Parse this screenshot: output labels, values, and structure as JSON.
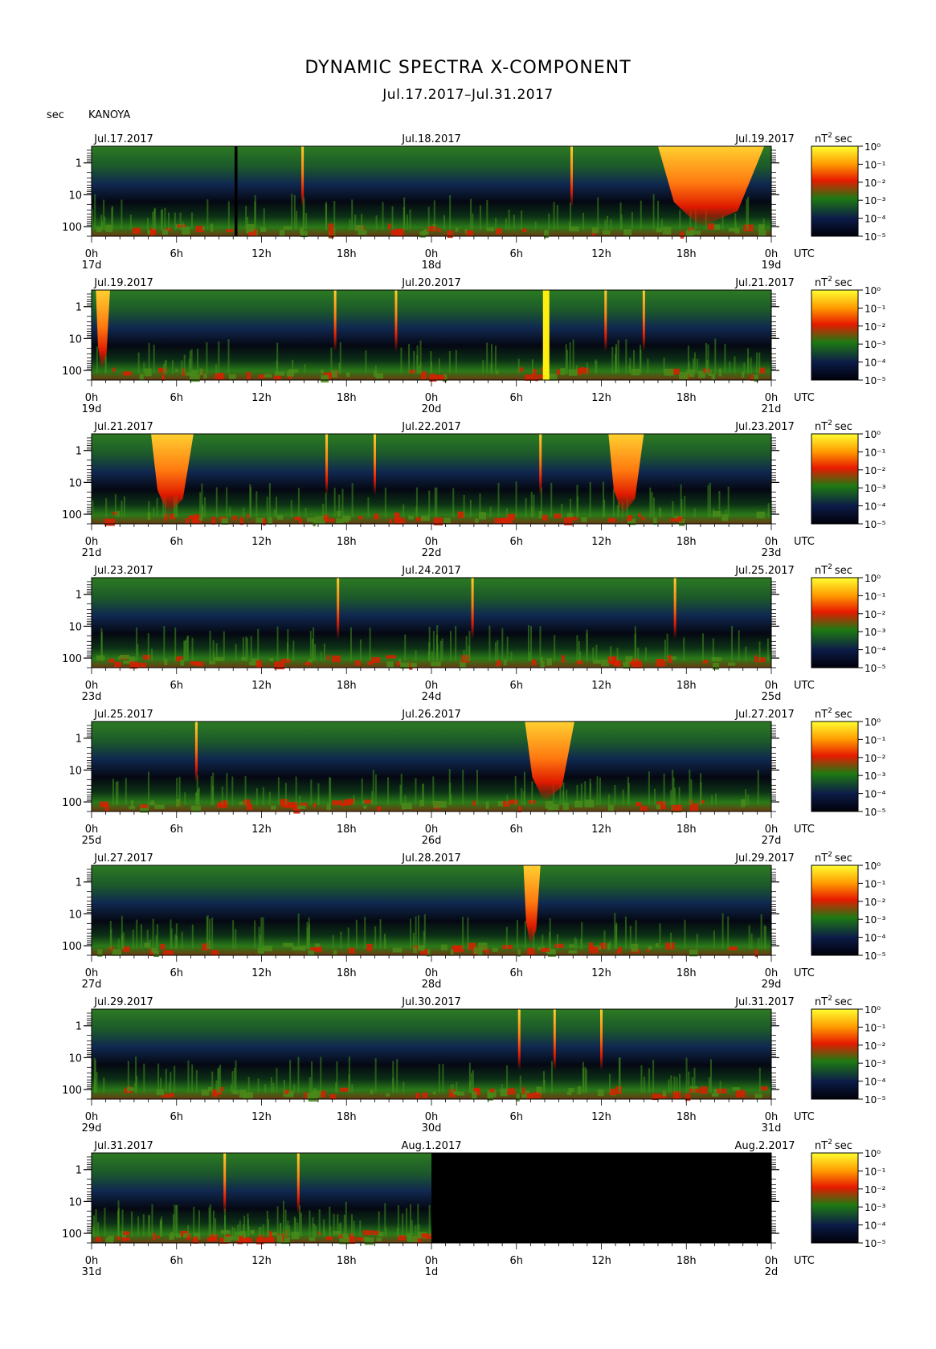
{
  "title": "DYNAMIC SPECTRA X-COMPONENT",
  "subtitle": "Jul.17.2017–Jul.31.2017",
  "station": "KANOYA",
  "yunit": "sec",
  "cbar_unit": "nT",
  "cbar_unit_sup": "2",
  "cbar_unit_suffix": "sec",
  "utc_label": "UTC",
  "chart_data": {
    "type": "heatmap",
    "xlabel": "UTC",
    "ylabel": "sec",
    "ylim": [
      0.3,
      200
    ],
    "yscale": "log",
    "yticks": [
      "1",
      "10",
      "100"
    ],
    "xticks": [
      "0h",
      "6h",
      "12h",
      "18h",
      "0h",
      "6h",
      "12h",
      "18h",
      "0h"
    ],
    "colorbar": {
      "unit": "nT² sec",
      "ticks": [
        "10⁰",
        "10⁻¹",
        "10⁻²",
        "10⁻³",
        "10⁻⁴",
        "10⁻⁵"
      ],
      "colors": [
        "#ffff00",
        "#ff9900",
        "#ff2200",
        "#1e7a12",
        "#10204a",
        "#000010"
      ]
    },
    "panels": [
      {
        "left_date": "Jul.17.2017",
        "mid_date": "Jul.18.2017",
        "right_date": "Jul.19.2017",
        "day_labels": [
          "17d",
          "18d",
          "19d"
        ],
        "events": [
          {
            "t": 14.9,
            "type": "spike"
          },
          {
            "t": 33.9,
            "type": "spike"
          },
          {
            "t": 40,
            "type": "storm",
            "width": 7.5
          }
        ],
        "gaps": [
          {
            "from": 10.1,
            "to": 10.3
          }
        ],
        "nodata_from": null
      },
      {
        "left_date": "Jul.19.2017",
        "mid_date": "Jul.20.2017",
        "right_date": "Jul.21.2017",
        "day_labels": [
          "19d",
          "20d",
          "21d"
        ],
        "events": [
          {
            "t": 0.3,
            "type": "storm",
            "width": 1
          },
          {
            "t": 17.2,
            "type": "spike"
          },
          {
            "t": 21.5,
            "type": "spike"
          },
          {
            "t": 32.1,
            "type": "block"
          },
          {
            "t": 36.3,
            "type": "spike"
          },
          {
            "t": 39.0,
            "type": "spike"
          }
        ],
        "gaps": [],
        "nodata_from": null
      },
      {
        "left_date": "Jul.21.2017",
        "mid_date": "Jul.22.2017",
        "right_date": "Jul.23.2017",
        "day_labels": [
          "21d",
          "22d",
          "23d"
        ],
        "events": [
          {
            "t": 4.2,
            "type": "storm",
            "width": 3
          },
          {
            "t": 16.6,
            "type": "spike"
          },
          {
            "t": 20.0,
            "type": "spike"
          },
          {
            "t": 31.7,
            "type": "spike"
          },
          {
            "t": 36.5,
            "type": "storm",
            "width": 2.5
          }
        ],
        "gaps": [],
        "nodata_from": null
      },
      {
        "left_date": "Jul.23.2017",
        "mid_date": "Jul.24.2017",
        "right_date": "Jul.25.2017",
        "day_labels": [
          "23d",
          "24d",
          "25d"
        ],
        "events": [
          {
            "t": 17.4,
            "type": "spike"
          },
          {
            "t": 26.9,
            "type": "spike"
          },
          {
            "t": 41.2,
            "type": "spike"
          }
        ],
        "gaps": [],
        "nodata_from": null
      },
      {
        "left_date": "Jul.25.2017",
        "mid_date": "Jul.26.2017",
        "right_date": "Jul.27.2017",
        "day_labels": [
          "25d",
          "26d",
          "27d"
        ],
        "events": [
          {
            "t": 7.4,
            "type": "spike"
          },
          {
            "t": 30.6,
            "type": "storm",
            "width": 3.5
          }
        ],
        "gaps": [],
        "nodata_from": null
      },
      {
        "left_date": "Jul.27.2017",
        "mid_date": "Jul.28.2017",
        "right_date": "Jul.29.2017",
        "day_labels": [
          "27d",
          "28d",
          "29d"
        ],
        "events": [
          {
            "t": 30.5,
            "type": "storm",
            "width": 1.2
          }
        ],
        "gaps": [],
        "nodata_from": null
      },
      {
        "left_date": "Jul.29.2017",
        "mid_date": "Jul.30.2017",
        "right_date": "Jul.31.2017",
        "day_labels": [
          "29d",
          "30d",
          "31d"
        ],
        "events": [
          {
            "t": 30.2,
            "type": "spike"
          },
          {
            "t": 32.7,
            "type": "spike"
          },
          {
            "t": 36.0,
            "type": "spike"
          }
        ],
        "gaps": [],
        "nodata_from": null
      },
      {
        "left_date": "Jul.31.2017",
        "mid_date": "Aug.1.2017",
        "right_date": "Aug.2.2017",
        "day_labels": [
          "31d",
          "1d",
          "2d"
        ],
        "events": [
          {
            "t": 9.4,
            "type": "spike"
          },
          {
            "t": 14.6,
            "type": "spike"
          }
        ],
        "gaps": [],
        "nodata_from": 24
      }
    ]
  }
}
